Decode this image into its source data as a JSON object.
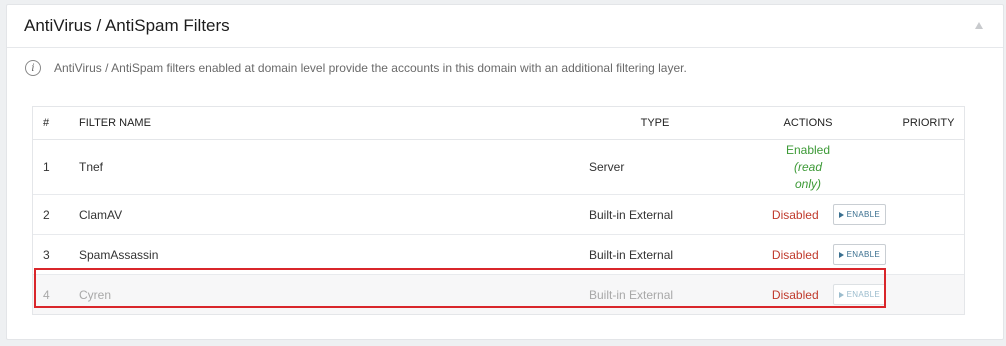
{
  "panel": {
    "title": "AntiVirus / AntiSpam Filters",
    "collapse_icon": "triangle-up-icon"
  },
  "info": {
    "icon": "info-icon",
    "text": "AntiVirus / AntiSpam filters enabled at domain level provide the accounts in this domain with an additional filtering layer."
  },
  "table": {
    "headers": {
      "num": "#",
      "name": "FILTER NAME",
      "type": "TYPE",
      "actions": "ACTIONS",
      "priority": "PRIORITY"
    },
    "rows": [
      {
        "num": "1",
        "name": "Tnef",
        "type": "Server",
        "status_line1": "Enabled",
        "status_line2": "(read",
        "status_line3": "only)"
      },
      {
        "num": "2",
        "name": "ClamAV",
        "type": "Built-in External",
        "status": "Disabled",
        "button": "ENABLE"
      },
      {
        "num": "3",
        "name": "SpamAssassin",
        "type": "Built-in External",
        "status": "Disabled",
        "button": "ENABLE"
      },
      {
        "num": "4",
        "name": "Cyren",
        "type": "Built-in External",
        "status": "Disabled",
        "button": "ENABLE"
      }
    ]
  },
  "colors": {
    "enabled": "#3d9a37",
    "disabled": "#c0392b",
    "highlight": "#d9262b"
  }
}
